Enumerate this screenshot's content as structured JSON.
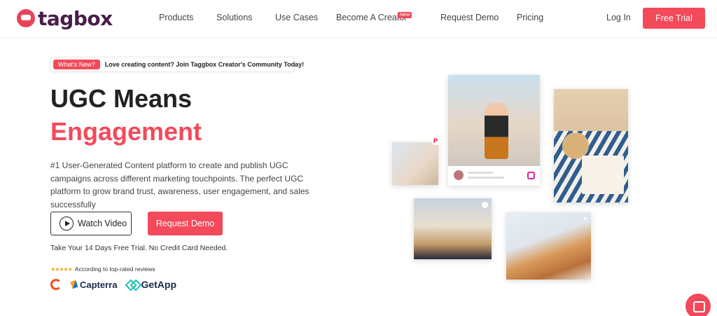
{
  "header": {
    "logo_text": "tagbox",
    "nav": [
      {
        "label": "Products"
      },
      {
        "label": "Solutions"
      },
      {
        "label": "Use Cases"
      },
      {
        "label": "Become A Creator",
        "badge": "New"
      },
      {
        "label": "Request Demo"
      },
      {
        "label": "Pricing"
      }
    ],
    "login_label": "Log In",
    "cta_label": "Free Trial"
  },
  "announcement": {
    "tag": "What's New?",
    "message": "Love creating content? Join Taggbox Creator's Community Today!"
  },
  "hero": {
    "title_line1": "UGC Means",
    "title_line2": "Engagement",
    "description": "#1 User-Generated Content platform to create and publish UGC campaigns across different marketing touchpoints. The perfect UGC platform to grow brand trust, awareness, user engagement, and sales successfully",
    "watch_video_label": "Watch Video",
    "request_demo_label": "Request Demo",
    "trial_note": "Take Your 14 Days Free Trial. No Credit Card Needed.",
    "rating_stars": "★★★★★",
    "rating_text": "According to top-rated reviews",
    "brands": [
      "Capterra",
      "GetApp"
    ]
  },
  "colors": {
    "accent": "#f24a5b",
    "logo": "#4a1d4a"
  }
}
